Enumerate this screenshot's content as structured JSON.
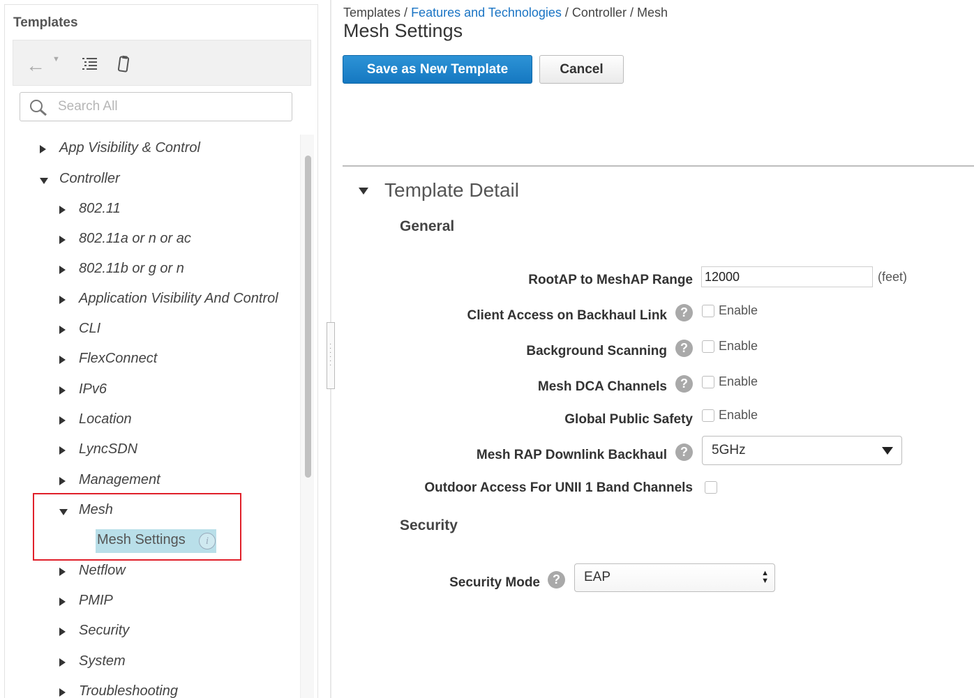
{
  "left_panel": {
    "title": "Templates",
    "search": {
      "placeholder": "Search All",
      "value": ""
    },
    "toolbar_icons": [
      "back-arrow-icon",
      "dropdown-caret-icon",
      "list-view-icon",
      "clipboard-icon"
    ],
    "tree": [
      {
        "label": "App Visibility & Control",
        "expanded": false,
        "level": 0
      },
      {
        "label": "Controller",
        "expanded": true,
        "level": 0
      },
      {
        "label": "802.11",
        "expanded": false,
        "level": 1
      },
      {
        "label": "802.11a or n or ac",
        "expanded": false,
        "level": 1
      },
      {
        "label": "802.11b or g or n",
        "expanded": false,
        "level": 1
      },
      {
        "label": "Application Visibility And Control",
        "expanded": false,
        "level": 1
      },
      {
        "label": "CLI",
        "expanded": false,
        "level": 1
      },
      {
        "label": "FlexConnect",
        "expanded": false,
        "level": 1
      },
      {
        "label": "IPv6",
        "expanded": false,
        "level": 1
      },
      {
        "label": "Location",
        "expanded": false,
        "level": 1
      },
      {
        "label": "LyncSDN",
        "expanded": false,
        "level": 1
      },
      {
        "label": "Management",
        "expanded": false,
        "level": 1
      },
      {
        "label": "Mesh",
        "expanded": true,
        "level": 1
      },
      {
        "label": "Mesh Settings",
        "selected": true,
        "level": 2
      },
      {
        "label": "Netflow",
        "expanded": false,
        "level": 1
      },
      {
        "label": "PMIP",
        "expanded": false,
        "level": 1
      },
      {
        "label": "Security",
        "expanded": false,
        "level": 1
      },
      {
        "label": "System",
        "expanded": false,
        "level": 1
      },
      {
        "label": "Troubleshooting",
        "expanded": false,
        "level": 1
      }
    ]
  },
  "breadcrumb": {
    "part1": "Templates",
    "sep": " / ",
    "link": "Features and Technologies",
    "part3": "Controller",
    "part4": "Mesh"
  },
  "page_title": "Mesh Settings",
  "buttons": {
    "save": "Save as New Template",
    "cancel": "Cancel"
  },
  "detail": {
    "title": "Template Detail",
    "general_heading": "General",
    "security_heading": "Security",
    "enable_label": "Enable",
    "fields": {
      "range": {
        "label": "RootAP to MeshAP Range",
        "value": "12000",
        "unit": "(feet)"
      },
      "client_access": {
        "label": "Client Access on Backhaul Link",
        "checked": false
      },
      "background_scanning": {
        "label": "Background Scanning",
        "checked": false
      },
      "dca_channels": {
        "label": "Mesh DCA Channels",
        "checked": false
      },
      "public_safety": {
        "label": "Global Public Safety",
        "checked": false
      },
      "downlink": {
        "label": "Mesh RAP Downlink Backhaul",
        "value": "5GHz"
      },
      "outdoor_access": {
        "label": "Outdoor Access For UNII 1 Band Channels",
        "checked": false
      },
      "security_mode": {
        "label": "Security Mode",
        "value": "EAP"
      }
    }
  },
  "colors": {
    "primary_button": "#1a80c8",
    "link": "#1a74c4",
    "selected_bg": "#b9dfe9",
    "highlight_border": "#e0202a"
  }
}
